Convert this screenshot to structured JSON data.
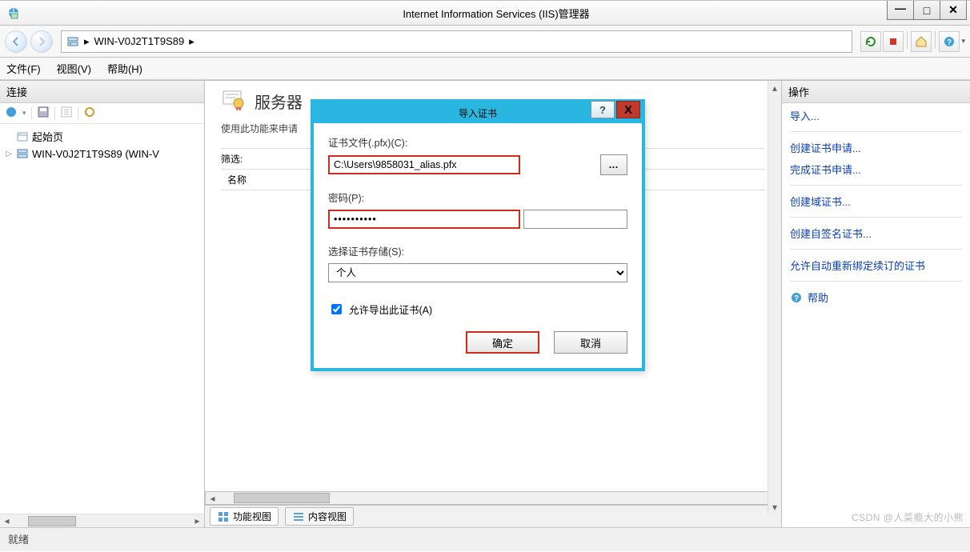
{
  "window": {
    "title": "Internet Information Services (IIS)管理器",
    "min_label": "–",
    "max_label": "□",
    "close_label": "X"
  },
  "breadcrumb": {
    "server": "WIN-V0J2T1T9S89",
    "sep": "▸"
  },
  "menu": {
    "file": "文件(F)",
    "view": "视图(V)",
    "help": "帮助(H)"
  },
  "left": {
    "title": "连接",
    "start_page": "起始页",
    "server_node": "WIN-V0J2T1T9S89 (WIN-V"
  },
  "center": {
    "feature_title": "服务器",
    "feature_desc": "使用此功能来申请",
    "filter_label": "筛选:",
    "col_name": "名称",
    "tab_features": "功能视图",
    "tab_content": "内容视图"
  },
  "actions": {
    "title": "操作",
    "import": "导入...",
    "create_request": "创建证书申请...",
    "complete_request": "完成证书申请...",
    "create_domain_cert": "创建域证书...",
    "create_self_signed": "创建自签名证书...",
    "auto_rebind": "允许自动重新绑定续订的证书",
    "help": "帮助"
  },
  "dialog": {
    "title": "导入证书",
    "help_btn": "?",
    "close_btn": "X",
    "file_label": "证书文件(.pfx)(C):",
    "file_value": "C:\\Users\\9858031_alias.pfx",
    "browse_btn": "…",
    "password_label": "密码(P):",
    "password_value": "••••••••••",
    "store_label": "选择证书存储(S):",
    "store_value": "个人",
    "allow_export": "允许导出此证书(A)",
    "ok": "确定",
    "cancel": "取消"
  },
  "status": {
    "ready": "就绪"
  },
  "watermark": "CSDN @人菜瘾大的小熊"
}
